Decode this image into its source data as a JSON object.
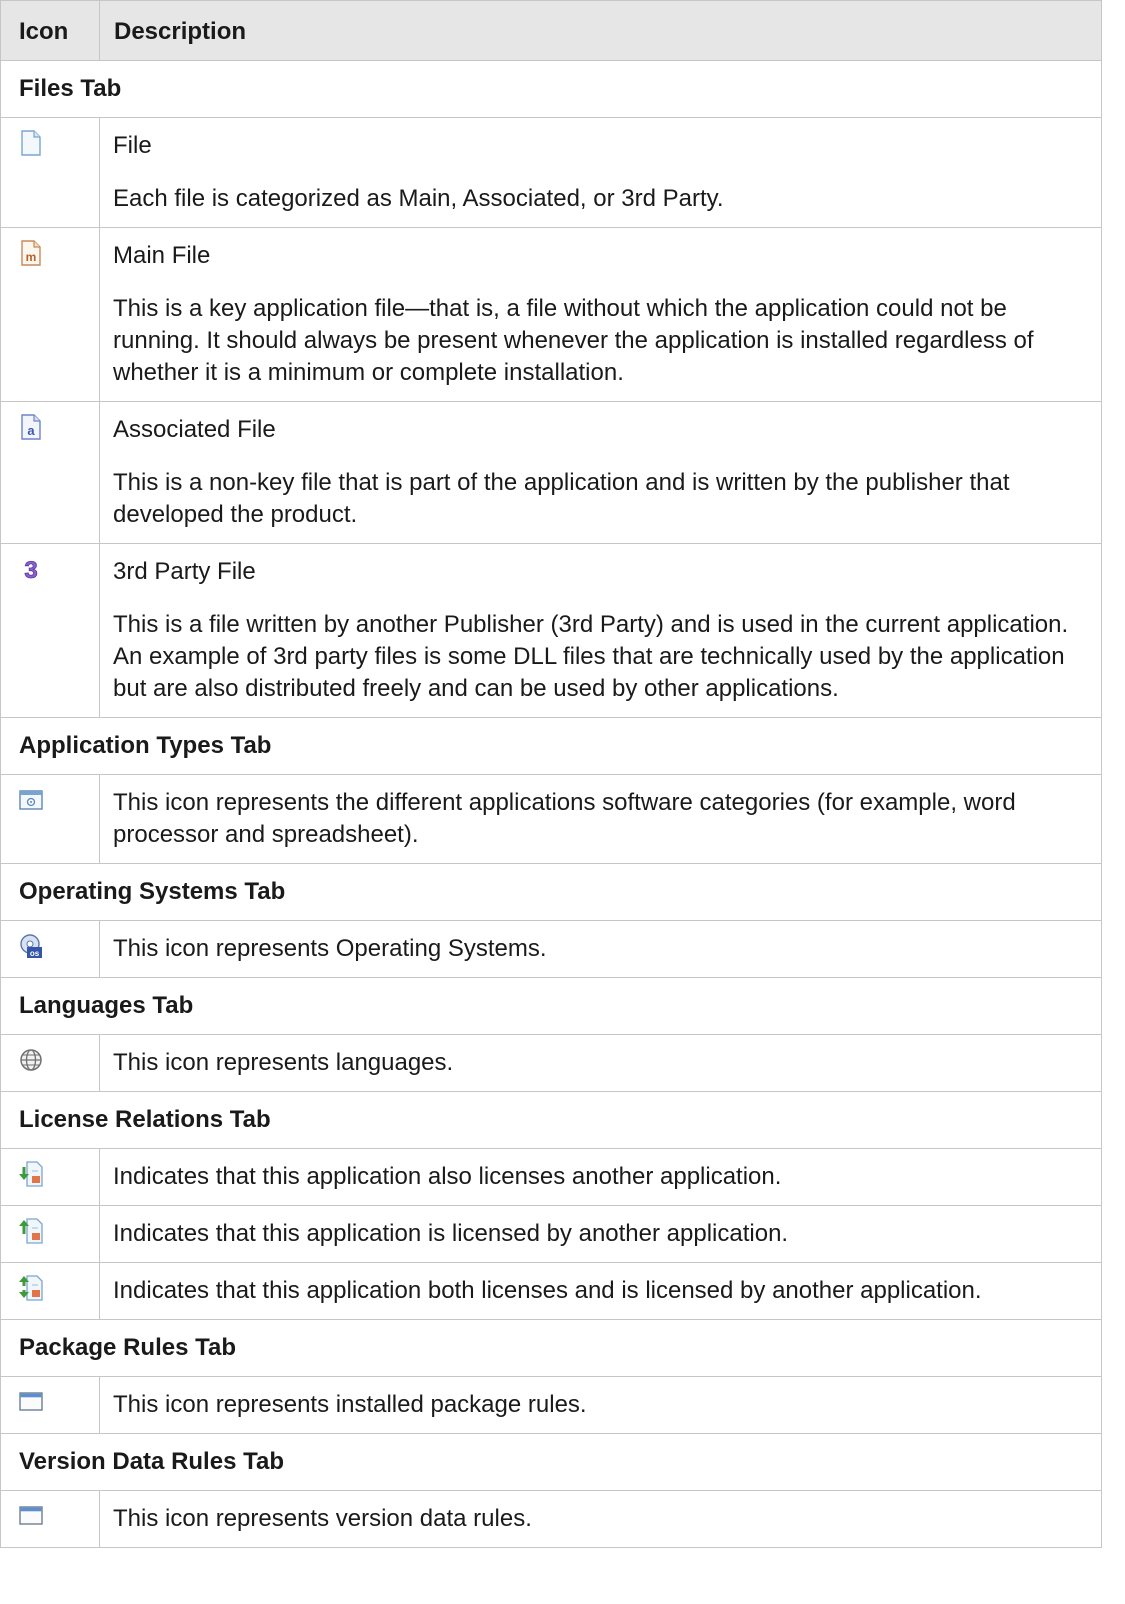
{
  "header": {
    "icon": "Icon",
    "description": "Description"
  },
  "sections": [
    {
      "title": "Files Tab",
      "rows": [
        {
          "icon": "file-icon",
          "paragraphs": [
            "File",
            "Each file is categorized as Main, Associated, or 3rd Party."
          ]
        },
        {
          "icon": "main-file-icon",
          "paragraphs": [
            "Main File",
            "This is a key application file—that is, a file without which the application could not be running. It should always be present whenever the application is installed regardless of whether it is a minimum or complete installation."
          ]
        },
        {
          "icon": "associated-file-icon",
          "paragraphs": [
            "Associated File",
            "This is a non-key file that is part of the application and is written by the publisher that developed the product."
          ]
        },
        {
          "icon": "third-party-file-icon",
          "paragraphs": [
            "3rd Party File",
            "This is a file written by another Publisher (3rd Party) and is used in the current application. An example of 3rd party files is some DLL files that are technically used by the application but are also distributed freely and can be used by other applications."
          ]
        }
      ]
    },
    {
      "title": "Application Types Tab",
      "rows": [
        {
          "icon": "application-type-icon",
          "paragraphs": [
            "This icon represents the different applications software categories (for example, word processor and spreadsheet)."
          ]
        }
      ]
    },
    {
      "title": "Operating Systems Tab",
      "rows": [
        {
          "icon": "operating-system-icon",
          "paragraphs": [
            "This icon represents Operating Systems."
          ]
        }
      ]
    },
    {
      "title": "Languages Tab",
      "rows": [
        {
          "icon": "language-globe-icon",
          "paragraphs": [
            "This icon represents languages."
          ]
        }
      ]
    },
    {
      "title": "License Relations Tab",
      "rows": [
        {
          "icon": "licenses-other-icon",
          "paragraphs": [
            "Indicates that this application also licenses another application."
          ]
        },
        {
          "icon": "licensed-by-other-icon",
          "paragraphs": [
            "Indicates that this application is licensed by another application."
          ]
        },
        {
          "icon": "licenses-both-icon",
          "paragraphs": [
            "Indicates that this application both licenses and is licensed by another application."
          ]
        }
      ]
    },
    {
      "title": "Package Rules Tab",
      "rows": [
        {
          "icon": "package-rule-window-icon",
          "paragraphs": [
            "This icon represents installed package rules."
          ]
        }
      ]
    },
    {
      "title": "Version Data Rules Tab",
      "rows": [
        {
          "icon": "version-rule-window-icon",
          "paragraphs": [
            "This icon represents version data rules."
          ]
        }
      ]
    }
  ]
}
